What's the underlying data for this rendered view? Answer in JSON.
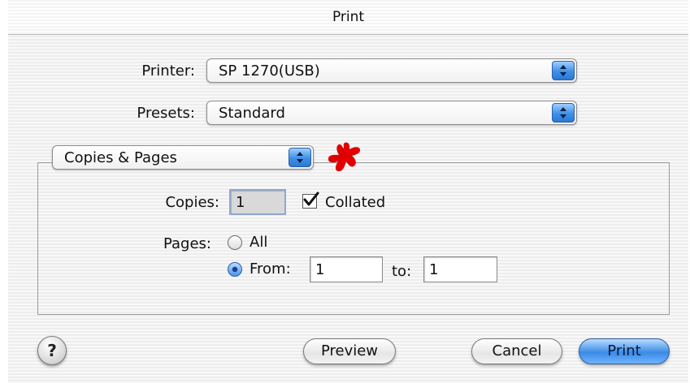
{
  "window": {
    "title": "Print"
  },
  "printer": {
    "label": "Printer:",
    "value": "SP 1270(USB)"
  },
  "presets": {
    "label": "Presets:",
    "value": "Standard"
  },
  "panel": {
    "value": "Copies & Pages"
  },
  "copies": {
    "label": "Copies:",
    "value": "1",
    "collated_label": "Collated",
    "collated_checked": true
  },
  "pages": {
    "label": "Pages:",
    "all_label": "All",
    "from_label": "From:",
    "from_value": "1",
    "to_label": "to:",
    "to_value": "1",
    "selected": "from"
  },
  "buttons": {
    "help": "?",
    "preview": "Preview",
    "cancel": "Cancel",
    "print": "Print"
  },
  "colors": {
    "accent_blue": "#3a8be6",
    "annotation_red": "#e00000"
  },
  "icons": {
    "popup_arrows": "up-down-arrows-icon",
    "checkbox": "checkmark-icon",
    "annotation": "red-star-mark"
  }
}
